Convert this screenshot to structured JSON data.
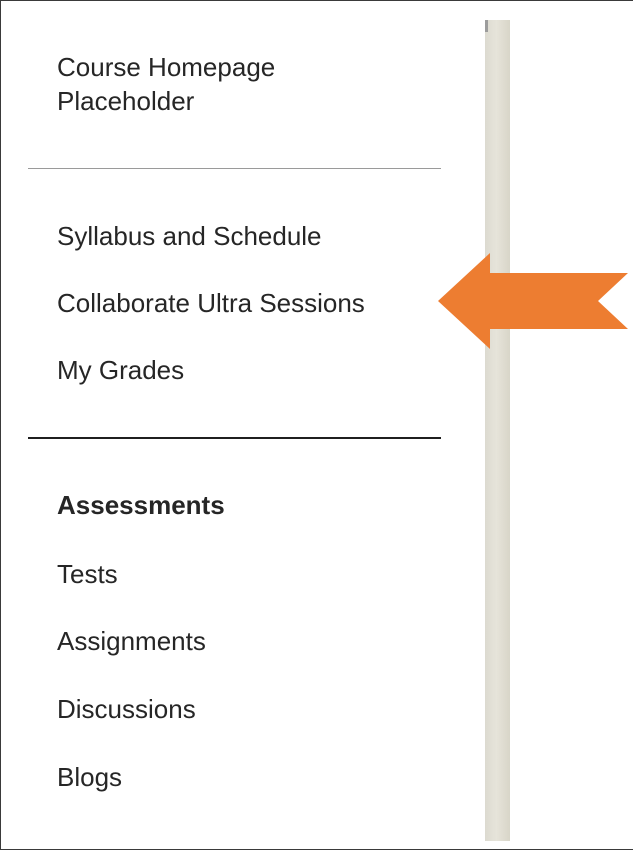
{
  "menu": {
    "homepage_label": "Course Homepage Placeholder",
    "items_top": [
      {
        "label": "Syllabus and Schedule"
      },
      {
        "label": "Collaborate Ultra Sessions"
      },
      {
        "label": "My Grades"
      }
    ],
    "assessments_heading": "Assessments",
    "items_bottom": [
      {
        "label": "Tests"
      },
      {
        "label": "Assignments"
      },
      {
        "label": "Discussions"
      },
      {
        "label": "Blogs"
      }
    ]
  },
  "annotation": {
    "arrow_icon": "left-arrow-icon",
    "arrow_color": "#ED7D31"
  },
  "colors": {
    "text": "#262626",
    "scrollbar": "#E0DED4"
  }
}
